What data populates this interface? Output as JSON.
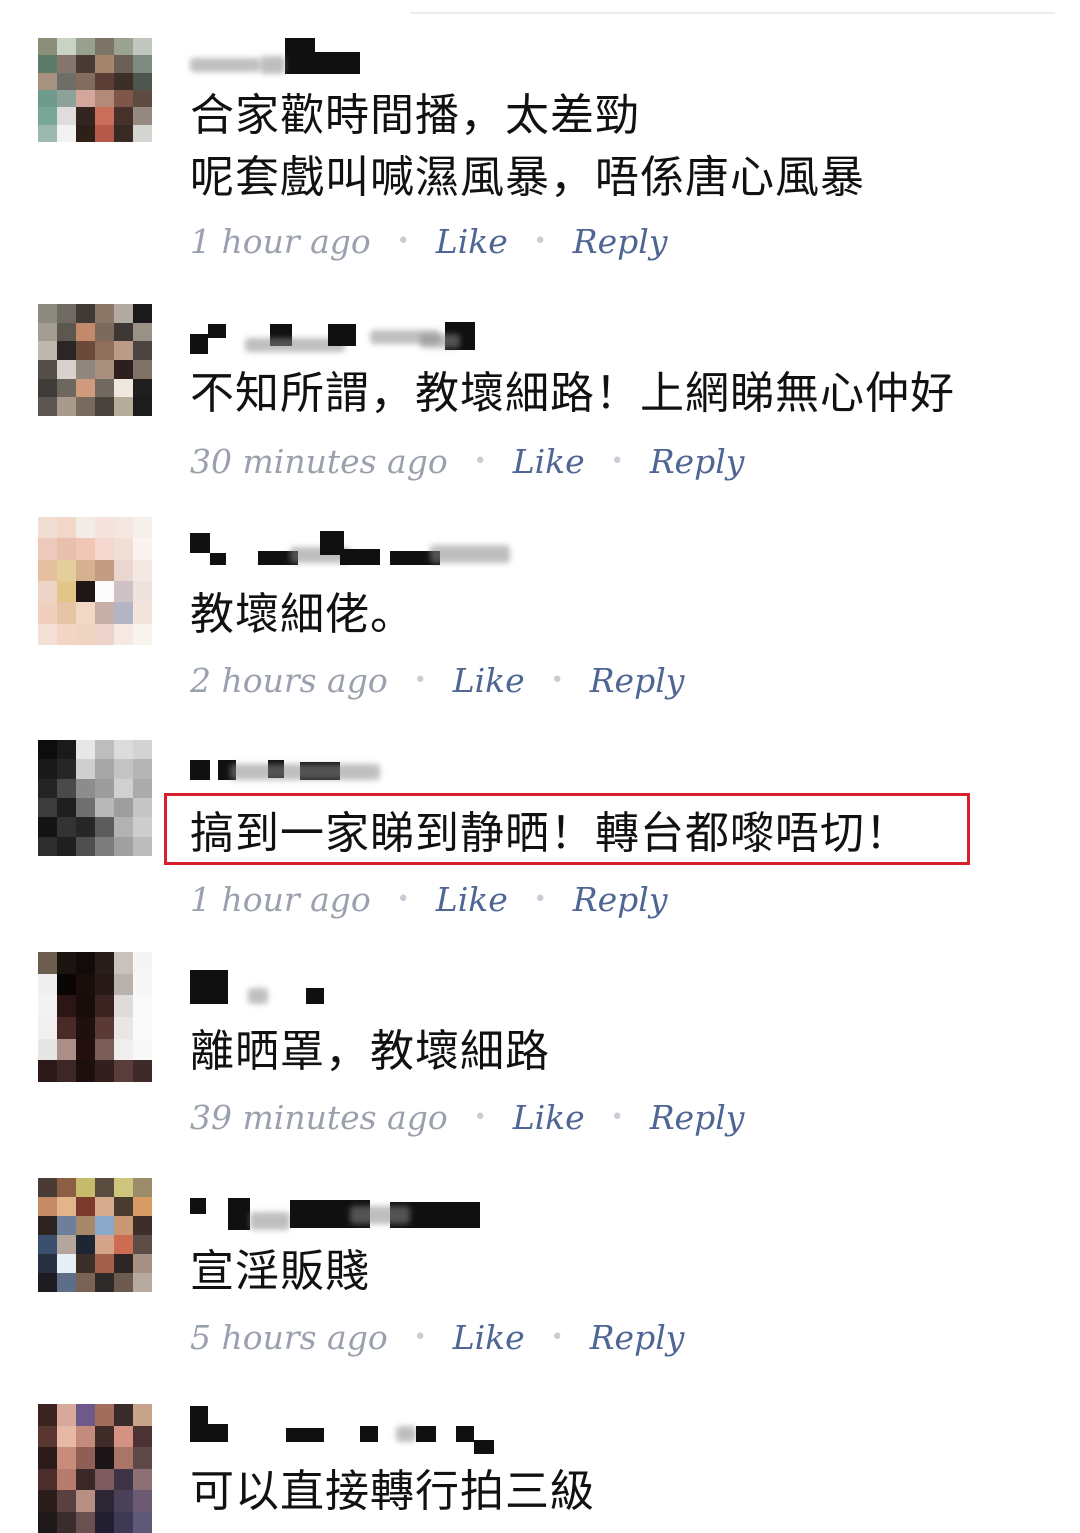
{
  "comments": [
    {
      "text_lines": [
        "合家歡時間播，太差勁",
        "呢套戲叫喊濕風暴，唔係唐心風暴"
      ],
      "time": "1 hour ago",
      "like": "Like",
      "reply": "Reply",
      "highlighted": false
    },
    {
      "text_lines": [
        "不知所謂，教壞細路！上網睇無心仲好"
      ],
      "time": "30 minutes ago",
      "like": "Like",
      "reply": "Reply",
      "highlighted": false
    },
    {
      "text_lines": [
        "教壞細佬。"
      ],
      "time": "2 hours ago",
      "like": "Like",
      "reply": "Reply",
      "highlighted": false
    },
    {
      "text_lines": [
        "搞到一家睇到静晒！轉台都嚟唔切！"
      ],
      "time": "1 hour ago",
      "like": "Like",
      "reply": "Reply",
      "highlighted": true
    },
    {
      "text_lines": [
        "離晒罩，教壞細路"
      ],
      "time": "39 minutes ago",
      "like": "Like",
      "reply": "Reply",
      "highlighted": false
    },
    {
      "text_lines": [
        "宣淫販賤"
      ],
      "time": "5 hours ago",
      "like": "Like",
      "reply": "Reply",
      "highlighted": false
    },
    {
      "text_lines": [
        "可以直接轉行拍三級"
      ],
      "time": "",
      "like": "",
      "reply": "",
      "highlighted": false
    }
  ],
  "colors": {
    "text": "#111111",
    "time": "#9aa0ad",
    "action": "#4f6694",
    "highlight_border": "#d6202b"
  },
  "separator": "•"
}
